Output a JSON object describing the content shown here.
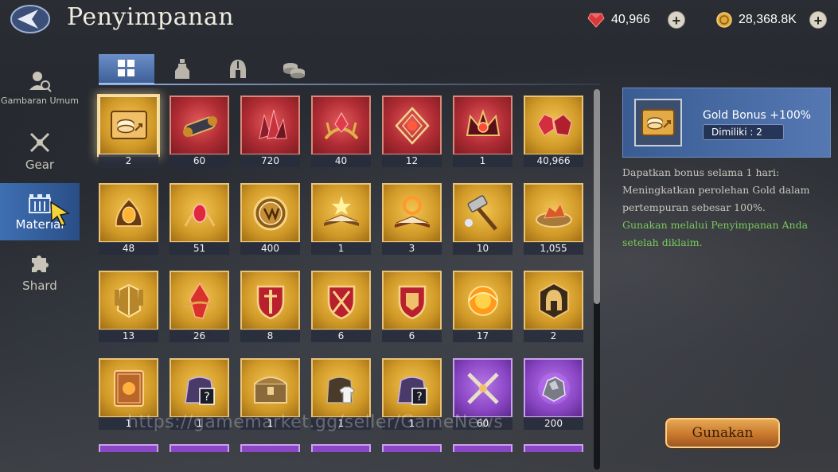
{
  "header": {
    "title": "Penyimpanan",
    "gems": "40,966",
    "gold": "28,368.8K"
  },
  "sidebar": {
    "items": [
      {
        "label": "Gambaran Umum",
        "icon": "search-user-icon"
      },
      {
        "label": "Gear",
        "icon": "crossed-swords-icon"
      },
      {
        "label": "Material",
        "icon": "castle-icon"
      },
      {
        "label": "Shard",
        "icon": "puzzle-icon"
      }
    ],
    "active": "Material"
  },
  "tabs": [
    "grid-icon",
    "potion-icon",
    "helmet-icon",
    "coins-icon"
  ],
  "items": [
    {
      "count": "2",
      "tier": "gold",
      "icon": "gold-bonus-ticket-icon",
      "selected": true
    },
    {
      "count": "60",
      "tier": "red",
      "icon": "scroll-icon"
    },
    {
      "count": "720",
      "tier": "red",
      "icon": "red-crystal-cluster-icon"
    },
    {
      "count": "40",
      "tier": "red",
      "icon": "red-gem-claw-icon"
    },
    {
      "count": "12",
      "tier": "red",
      "icon": "gem-cage-icon"
    },
    {
      "count": "1",
      "tier": "red",
      "icon": "ornate-crown-icon"
    },
    {
      "count": "40,966",
      "tier": "gold",
      "icon": "red-gems-icon"
    },
    {
      "count": "48",
      "tier": "gold",
      "icon": "amber-gem-icon"
    },
    {
      "count": "51",
      "tier": "gold",
      "icon": "ruby-claw-icon"
    },
    {
      "count": "400",
      "tier": "gold",
      "icon": "coin-emblem-icon"
    },
    {
      "count": "1",
      "tier": "gold",
      "icon": "glowing-book-icon"
    },
    {
      "count": "3",
      "tier": "gold",
      "icon": "ring-book-icon"
    },
    {
      "count": "10",
      "tier": "gold",
      "icon": "hammer-icon"
    },
    {
      "count": "1,055",
      "tier": "gold",
      "icon": "ore-plate-icon"
    },
    {
      "count": "13",
      "tier": "gold",
      "icon": "golden-armor-icon"
    },
    {
      "count": "26",
      "tier": "gold",
      "icon": "red-shard-icon"
    },
    {
      "count": "8",
      "tier": "gold",
      "icon": "sword-shield-icon"
    },
    {
      "count": "6",
      "tier": "gold",
      "icon": "crossed-shield-icon"
    },
    {
      "count": "6",
      "tier": "gold",
      "icon": "armor-shield-icon"
    },
    {
      "count": "17",
      "tier": "gold",
      "icon": "fire-orb-icon"
    },
    {
      "count": "2",
      "tier": "gold",
      "icon": "helmet-badge-icon"
    },
    {
      "count": "1",
      "tier": "gold",
      "icon": "card-icon"
    },
    {
      "count": "1",
      "tier": "gold",
      "icon": "mystery-bag-icon"
    },
    {
      "count": "1",
      "tier": "gold",
      "icon": "treasure-chest-icon"
    },
    {
      "count": "1",
      "tier": "gold",
      "icon": "clothes-bag-icon"
    },
    {
      "count": "1",
      "tier": "gold",
      "icon": "mystery-bag-icon"
    },
    {
      "count": "60",
      "tier": "purple",
      "icon": "crossed-swords-icon"
    },
    {
      "count": "200",
      "tier": "purple",
      "icon": "crystal-ore-icon"
    }
  ],
  "detail": {
    "name": "Gold Bonus +100%",
    "owned": "Dimiliki : 2",
    "desc_1": "Dapatkan bonus selama 1 hari:",
    "desc_2": "Meningkatkan perolehan Gold dalam",
    "desc_3": "pertempuran sebesar 100%.",
    "desc_4": "Gunakan melalui Penyimpanan Anda",
    "desc_5": "setelah diklaim.",
    "use_button": "Gunakan"
  },
  "watermark": "https://gamemarket.gg/seller/GameNews",
  "colors": {
    "tier_gold": "#d19a28",
    "tier_red": "#b02c34",
    "tier_purple": "#8a46c4",
    "active_blue": "#3e6fb2",
    "highlight_green": "#79c95a"
  }
}
